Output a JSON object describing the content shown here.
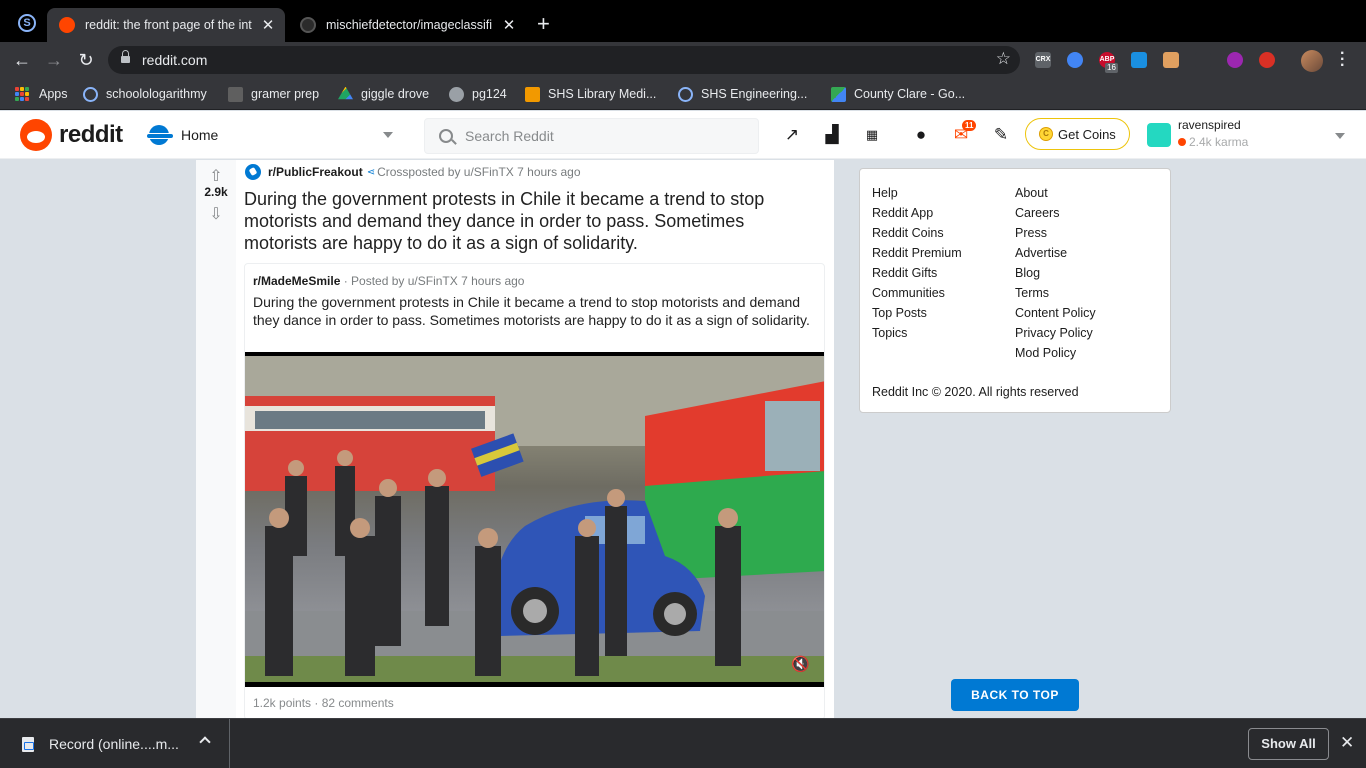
{
  "browser": {
    "tabs": [
      {
        "title": "reddit: the front page of the int",
        "active": true,
        "icon": "reddit-icon"
      },
      {
        "title": "mischiefdetector/imageclassifi",
        "active": false,
        "icon": "github-icon"
      }
    ],
    "address": "reddit.com",
    "extensions": [
      {
        "label": "CRX",
        "color": "#5f6368"
      },
      {
        "label": "",
        "color": "#4285f4"
      },
      {
        "label": "ABP",
        "color": "#c70d2c",
        "badge": "16"
      },
      {
        "label": "",
        "color": "#1a8fe0"
      },
      {
        "label": "",
        "color": "#e0a060"
      },
      {
        "label": "",
        "color": "#35363a"
      },
      {
        "label": "",
        "color": "#9c27b0"
      },
      {
        "label": "",
        "color": "#d93025"
      }
    ]
  },
  "bookmarks": [
    {
      "label": "Apps",
      "icon": "apps-grid-icon"
    },
    {
      "label": "schoolologarithmy",
      "icon": "schoology-icon",
      "color": "#8ab4f8"
    },
    {
      "label": "gramer prep",
      "icon": "gb-icon",
      "color": "#5f5f5f"
    },
    {
      "label": "giggle drove",
      "icon": "google-drive-icon",
      "color": "#1fa463"
    },
    {
      "label": "pg124",
      "icon": "globe-icon",
      "color": "#9aa0a6"
    },
    {
      "label": "SHS Library Medi...",
      "icon": "library-icon",
      "color": "#f29900"
    },
    {
      "label": "SHS Engineering...",
      "icon": "schoology-icon",
      "color": "#8ab4f8"
    },
    {
      "label": "County Clare - Go...",
      "icon": "google-maps-icon",
      "color": "#34a853"
    }
  ],
  "reddit_header": {
    "logo_text": "reddit",
    "feed": "Home",
    "search_placeholder": "Search Reddit",
    "mail_badge": "11",
    "get_coins": "Get Coins",
    "coin_symbol": "C",
    "username": "ravenspired",
    "karma": "2.4k karma"
  },
  "post": {
    "votes": "2.9k",
    "subreddit": "r/PublicFreakout",
    "crosspost_info": "Crossposted by u/SFinTX 7 hours ago",
    "title": "During the government protests in Chile it became a trend to stop motorists and demand they dance in order to pass. Sometimes motorists are happy to do it as a sign of solidarity.",
    "crosspost": {
      "subreddit": "r/MadeMeSmile",
      "posted_by": "· Posted by u/SFinTX 7 hours ago",
      "title": "During the government protests in Chile it became a trend to stop motorists and demand they dance in order to pass. Sometimes motorists are happy to do it as a sign of solidarity.",
      "stats": "1.2k points · 82 comments"
    }
  },
  "sidebar": {
    "col1": [
      "Help",
      "Reddit App",
      "Reddit Coins",
      "Reddit Premium",
      "Reddit Gifts",
      "Communities",
      "Top Posts",
      "Topics"
    ],
    "col2": [
      "About",
      "Careers",
      "Press",
      "Advertise",
      "Blog",
      "Terms",
      "Content Policy",
      "Privacy Policy",
      "Mod Policy"
    ],
    "copyright": "Reddit Inc © 2020. All rights reserved",
    "back_to_top": "BACK TO TOP"
  },
  "downloads": {
    "file_name": "Record (online....m...",
    "show_all": "Show All"
  }
}
